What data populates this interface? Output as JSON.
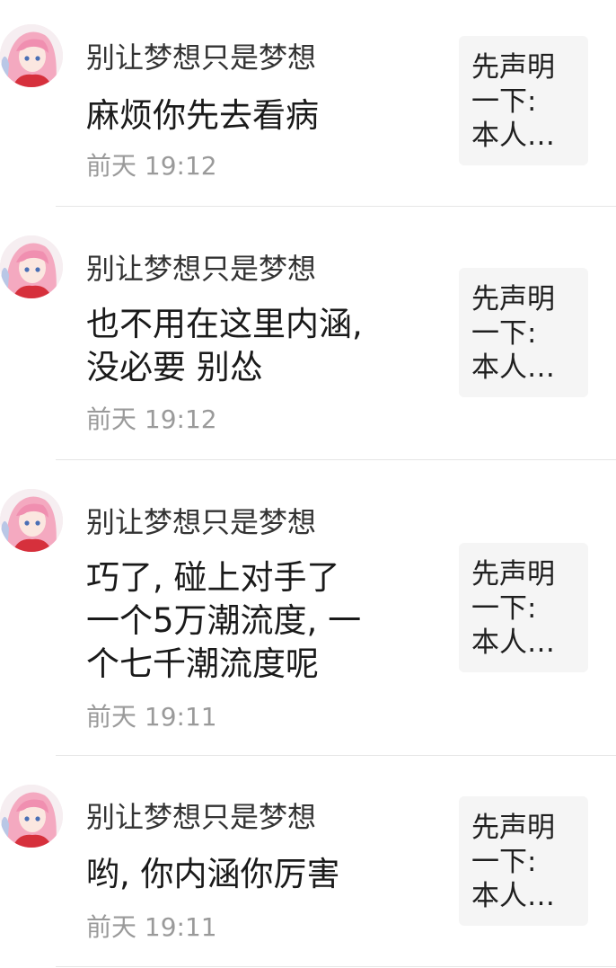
{
  "comments": [
    {
      "username": "别让梦想只是梦想",
      "message_lines": [
        "麻烦你先去看病"
      ],
      "time": "前天 19:12",
      "reference_lines": [
        "先声明",
        "一下:",
        "本人…"
      ]
    },
    {
      "username": "别让梦想只是梦想",
      "message_lines": [
        "也不用在这里内涵,",
        "没必要  别怂"
      ],
      "time": "前天 19:12",
      "reference_lines": [
        "先声明",
        "一下:",
        "本人…"
      ]
    },
    {
      "username": "别让梦想只是梦想",
      "message_lines": [
        "巧了, 碰上对手了",
        "一个5万潮流度, 一",
        "个七千潮流度呢"
      ],
      "time": "前天 19:11",
      "reference_lines": [
        "先声明",
        "一下:",
        "本人…"
      ]
    },
    {
      "username": "别让梦想只是梦想",
      "message_lines": [
        "哟, 你内涵你厉害"
      ],
      "time": "前天 19:11",
      "reference_lines": [
        "先声明",
        "一下:",
        "本人…"
      ]
    }
  ],
  "colors": {
    "username": "#333333",
    "time": "#9a9a9a",
    "reference_bg": "#f5f5f5",
    "divider": "#e6e6e6",
    "avatar_hair": "#f4a9c0"
  },
  "icons": {
    "avatar": "anime-girl-avatar"
  }
}
